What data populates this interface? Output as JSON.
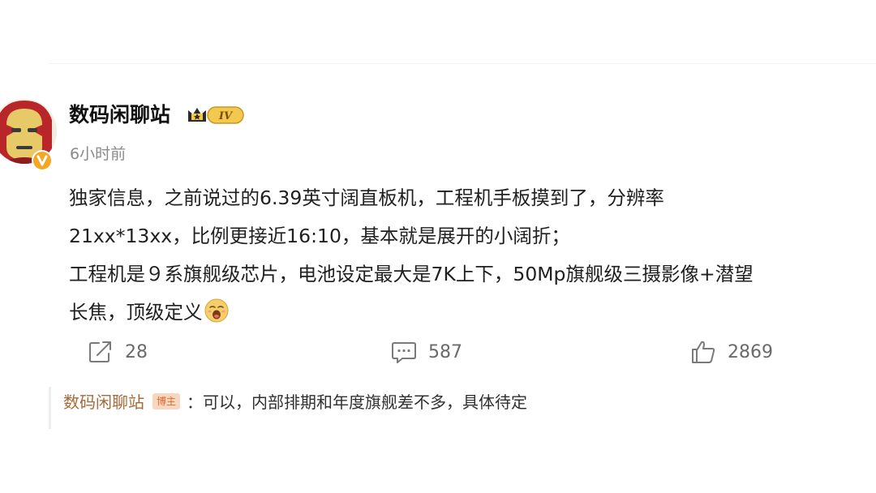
{
  "post": {
    "username": "数码闲聊站",
    "rank_badge": "IV",
    "timestamp": "6小时前",
    "lines": [
      "独家信息，之前说过的6.39英寸阔直板机，工程机手板摸到了，分辨率",
      "21xx*13xx，比例更接近16:10，基本就是展开的小阔折；",
      "工程机是９系旗舰级芯片，电池设定最大是7K上下，50Mp旗舰级三摄影像+潜望",
      "长焦，顶级定义"
    ],
    "emoji": "yawn-emoji"
  },
  "actions": {
    "repost_count": "28",
    "comment_count": "587",
    "like_count": "2869"
  },
  "comment": {
    "author": "数码闲聊站",
    "author_tag": "博主",
    "text": "：可以，内部排期和年度旗舰差不多，具体待定"
  },
  "colors": {
    "verify_badge": "#f5a623",
    "rank_gold": "#f2c94c",
    "author_tag_bg": "#f7d7c0",
    "author_tag_text": "#e06b2a",
    "comment_author": "#a66a3a"
  }
}
